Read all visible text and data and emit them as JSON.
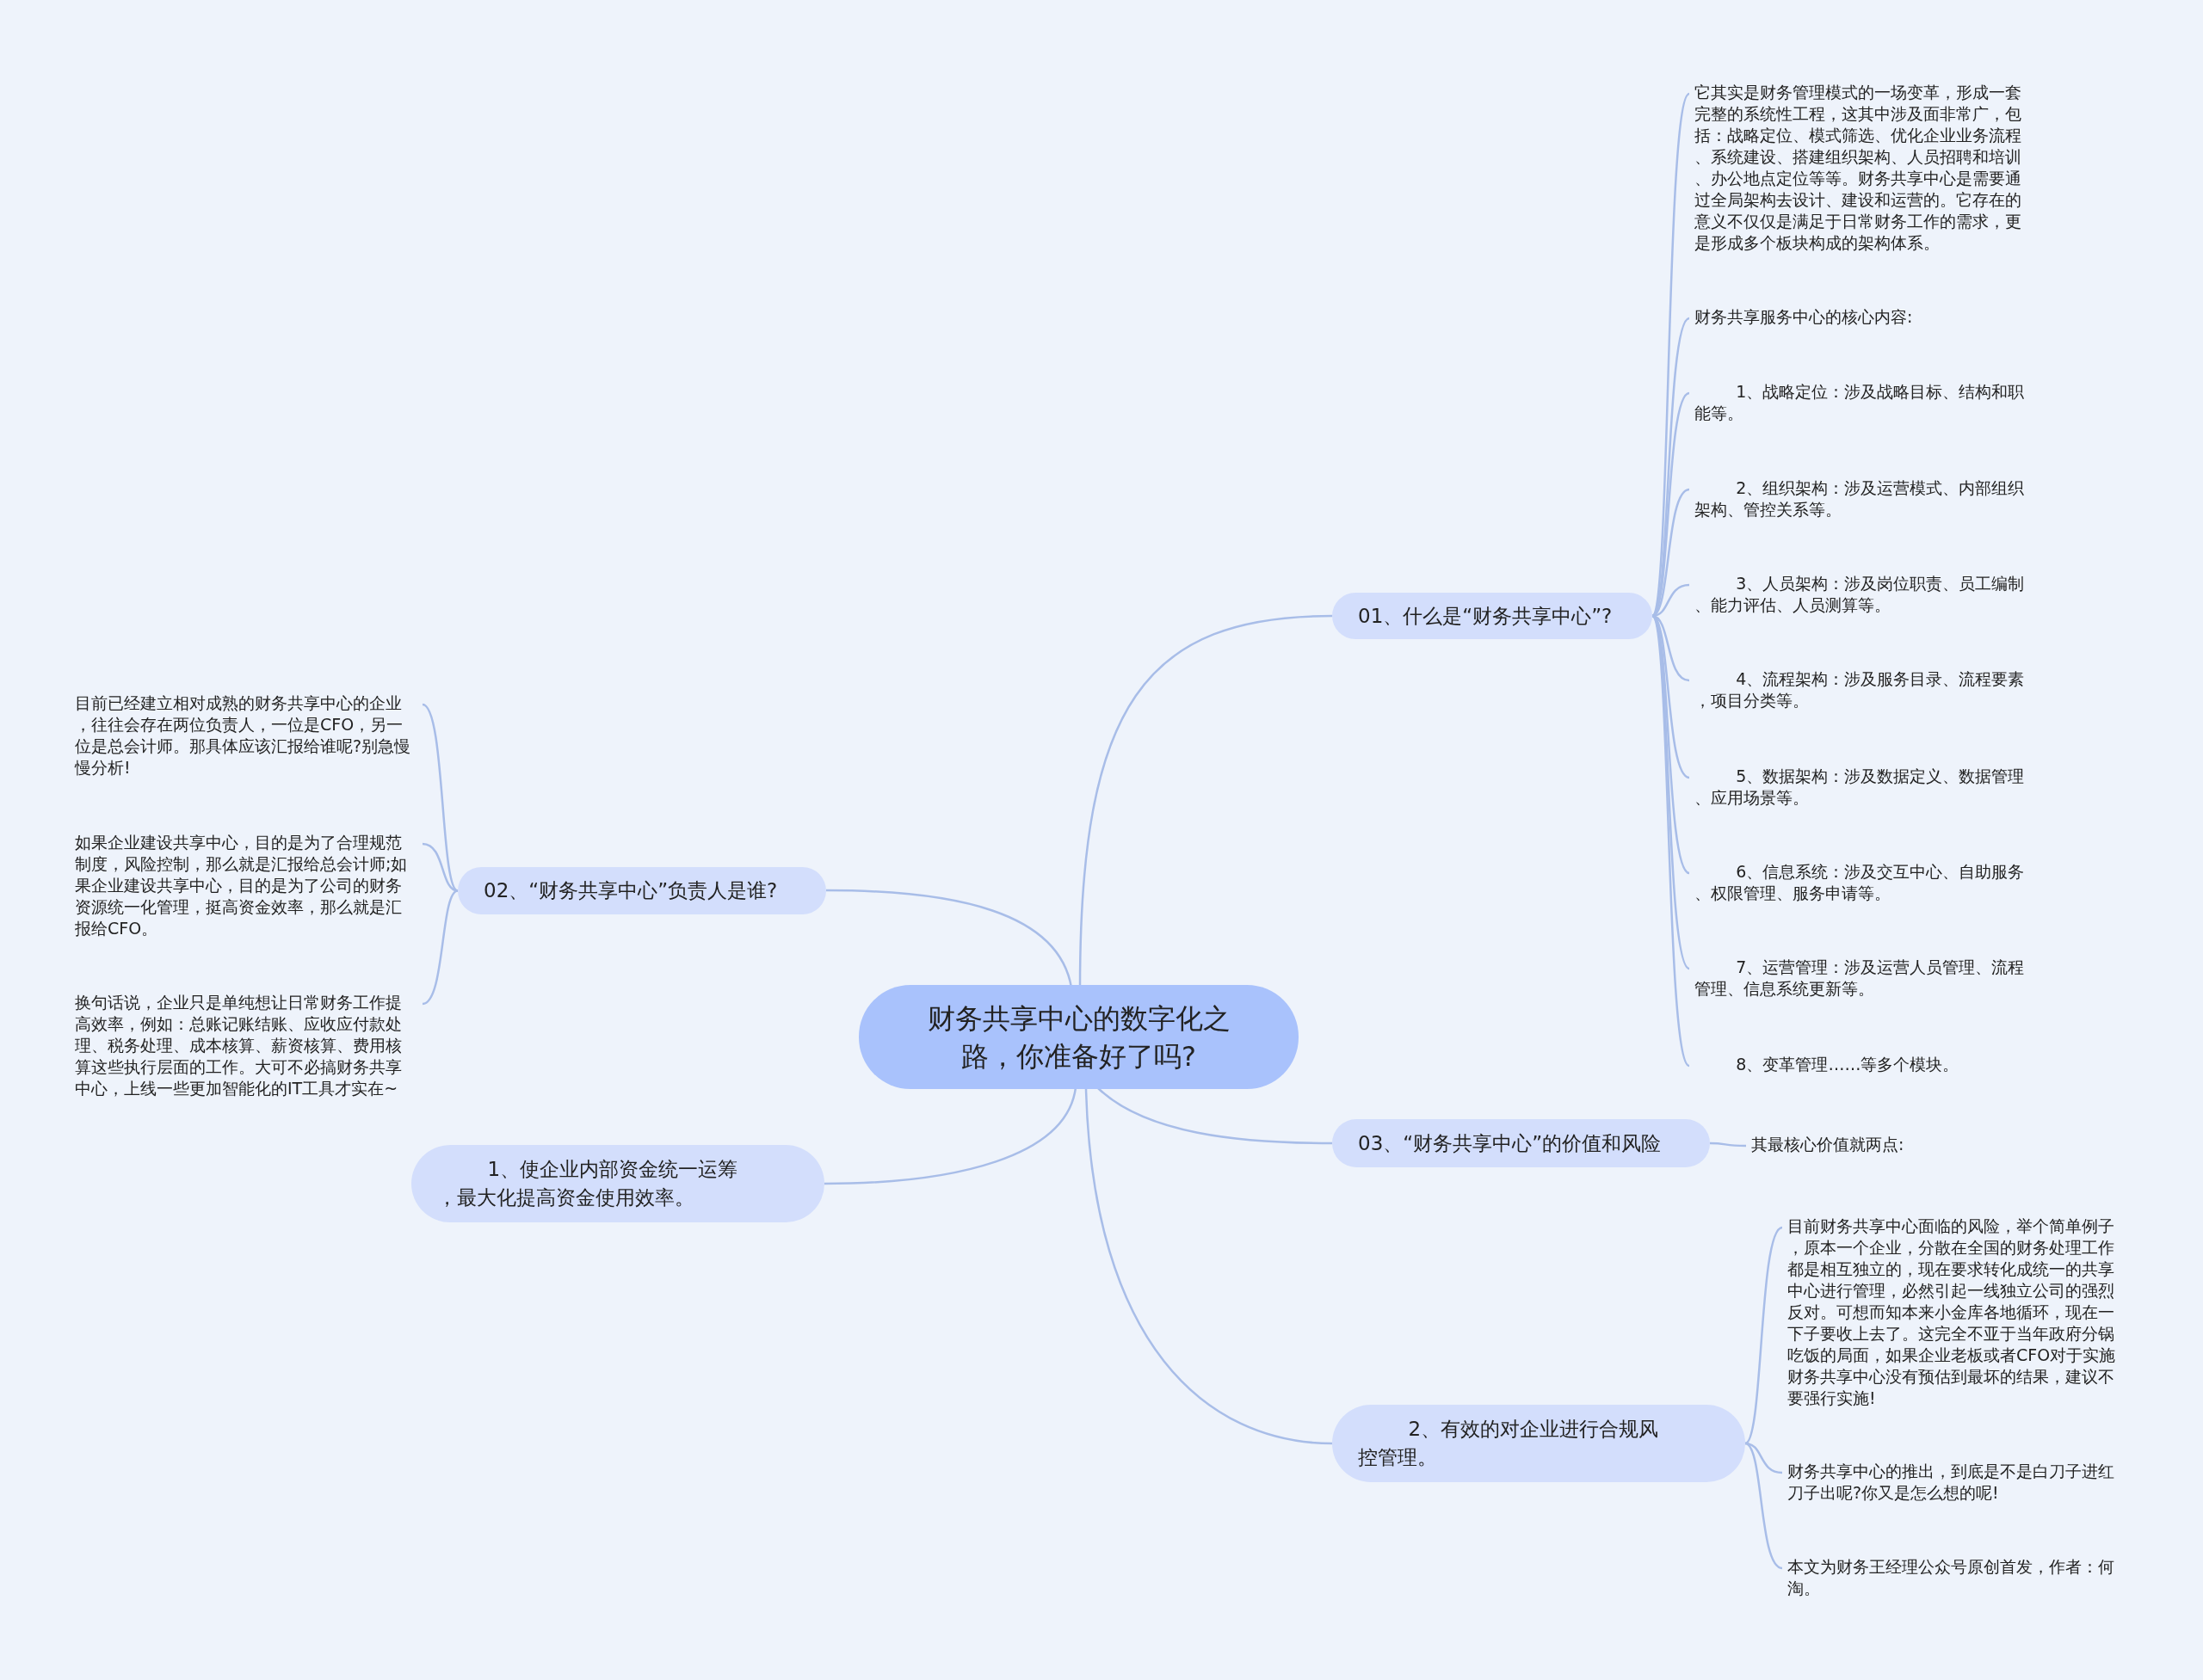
{
  "central_topic": "财务共享中心的数字化之路，你准备好了吗?",
  "branches": [
    {
      "label": "01、什么是“财务共享中心”?",
      "notes": [
        "它其实是财务管理模式的一场变革，形成一套完整的系统性工程，这其中涉及面非常广，包括：战略定位、模式筛选、优化企业业务流程、系统建设、搭建组织架构、人员招聘和培训、办公地点定位等等。财务共享中心是需要通过全局架构去设计、建设和运营的。它存在的意义不仅仅是满足于日常财务工作的需求，更是形成多个板块构成的架构体系。",
        "财务共享服务中心的核心内容:",
        "        1、战略定位：涉及战略目标、结构和职能等。",
        "        2、组织架构：涉及运营模式、内部组织架构、管控关系等。",
        "        3、人员架构：涉及岗位职责、员工编制、能力评估、人员测算等。",
        "        4、流程架构：涉及服务目录、流程要素，项目分类等。",
        "        5、数据架构：涉及数据定义、数据管理、应用场景等。",
        "        6、信息系统：涉及交互中心、自助服务、权限管理、服务申请等。",
        "        7、运营管理：涉及运营人员管理、流程管理、信息系统更新等。",
        "        8、变革管理……等多个模块。"
      ]
    },
    {
      "label": "02、“财务共享中心”负责人是谁?",
      "notes": [
        "目前已经建立相对成熟的财务共享中心的企业，往往会存在两位负责人，一位是CFO，另一位是总会计师。那具体应该汇报给谁呢?别急慢慢分析!",
        "如果企业建设共享中心，目的是为了合理规范制度，风险控制，那么就是汇报给总会计师;如果企业建设共享中心，目的是为了公司的财务资源统一化管理，挺高资金效率，那么就是汇报给CFO。",
        "换句话说，企业只是单纯想让日常财务工作提高效率，例如：总账记账结账、应收应付款处理、税务处理、成本核算、薪资核算、费用核算这些执行层面的工作。大可不必搞财务共享中心，上线一些更加智能化的IT工具才实在~"
      ]
    },
    {
      "label": "        1、使企业内部资金统一运筹，最大化提高资金使用效率。"
    },
    {
      "label": "03、“财务共享中心”的价值和风险",
      "notes": [
        "其最核心价值就两点:"
      ]
    },
    {
      "label": "        2、有效的对企业进行合规风控管理。",
      "notes": [
        "目前财务共享中心面临的风险，举个简单例子，原本一个企业，分散在全国的财务处理工作都是相互独立的，现在要求转化成统一的共享中心进行管理，必然引起一线独立公司的强烈反对。可想而知本来小金库各地循环，现在一下子要收上去了。这完全不亚于当年政府分锅吃饭的局面，如果企业老板或者CFO对于实施财务共享中心没有预估到最坏的结果，建议不要强行实施!",
        "财务共享中心的推出，到底是不是白刀子进红刀子出呢?你又是怎么想的呢!",
        "本文为财务王经理公众号原创首发，作者：何淘。"
      ]
    }
  ]
}
